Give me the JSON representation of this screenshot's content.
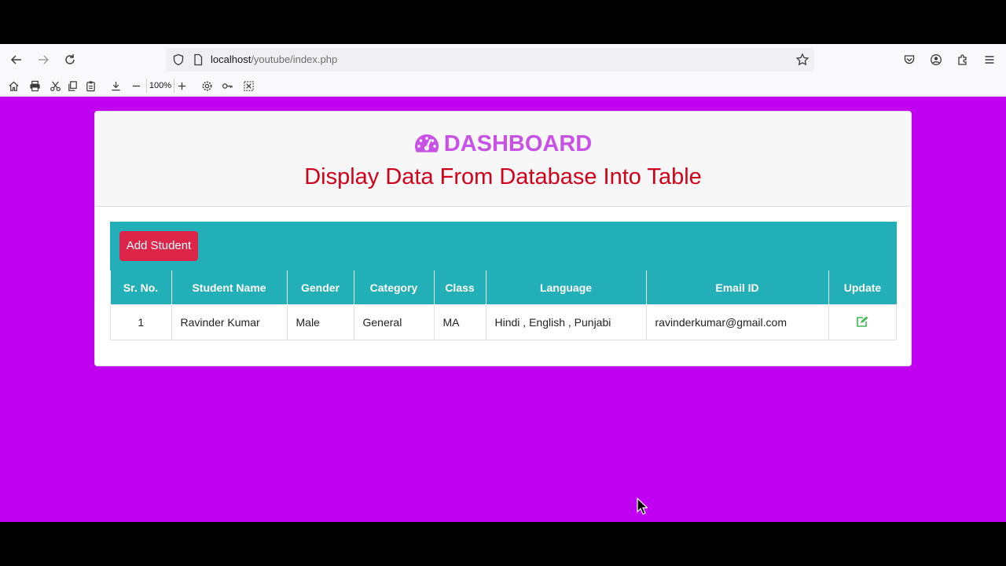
{
  "browser": {
    "url_host": "localhost",
    "url_path": "/youtube/index.php",
    "zoom": "100%"
  },
  "page": {
    "title": "DASHBOARD",
    "subtitle": "Display Data From Database Into Table",
    "add_button": "Add Student"
  },
  "table": {
    "headers": [
      "Sr. No.",
      "Student Name",
      "Gender",
      "Category",
      "Class",
      "Language",
      "Email ID",
      "Update"
    ],
    "rows": [
      [
        "1",
        "Ravinder Kumar",
        "Male",
        "General",
        "MA",
        "Hindi , English , Punjabi",
        "ravinderkumar@gmail.com"
      ]
    ]
  },
  "colors": {
    "page_bg": "#c000f0",
    "title": "#c952e6",
    "subtitle": "#d0021b",
    "teal": "#23afb7",
    "add_button": "#dc2549",
    "edit_icon": "#3fb950"
  },
  "icons": {
    "title": "tachometer-icon",
    "update": "edit-icon"
  }
}
